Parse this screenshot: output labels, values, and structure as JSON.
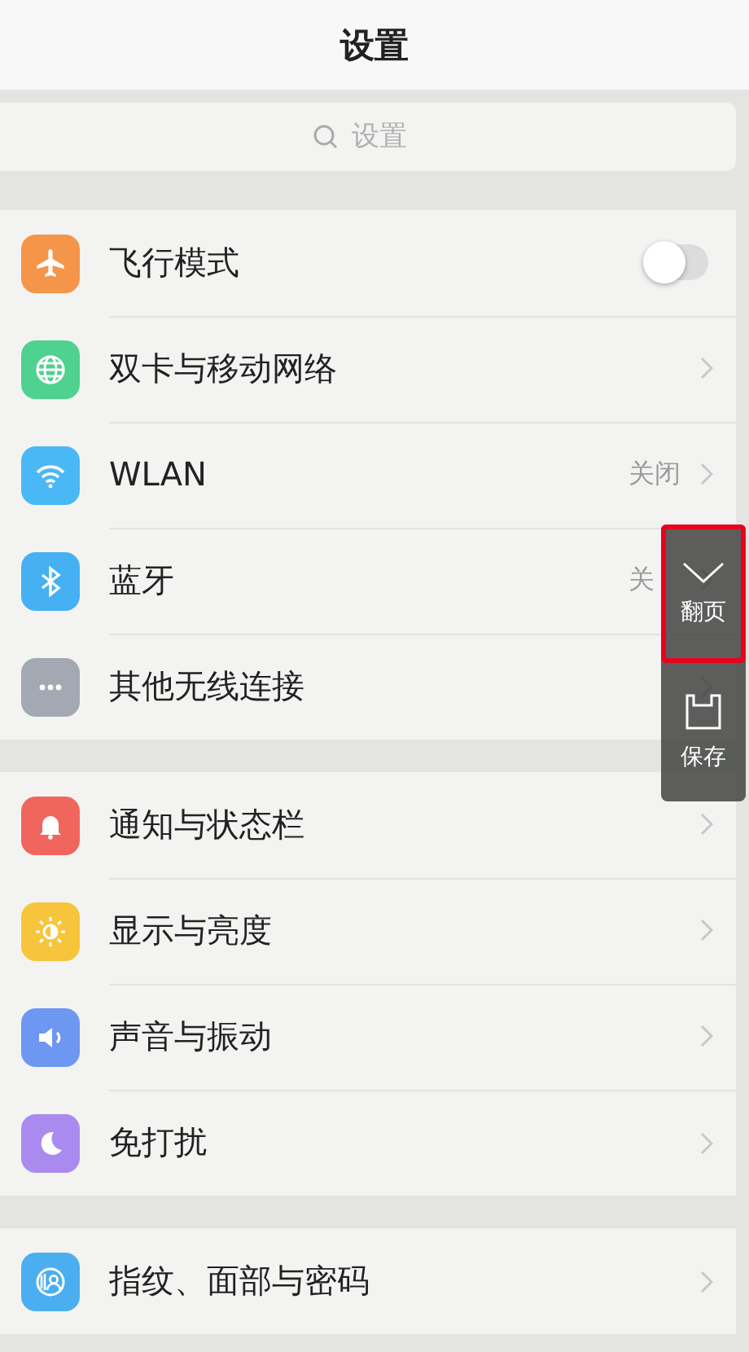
{
  "header": {
    "title": "设置"
  },
  "search": {
    "placeholder": "设置"
  },
  "groups": [
    {
      "items": [
        {
          "label": "飞行模式",
          "kind": "toggle",
          "on": false,
          "color": "#f5954a"
        },
        {
          "label": "双卡与移动网络",
          "kind": "link",
          "color": "#4fd18f"
        },
        {
          "label": "WLAN",
          "kind": "link",
          "value": "关闭",
          "color": "#4ab8f5"
        },
        {
          "label": "蓝牙",
          "kind": "link",
          "value": "关",
          "color": "#45b0f2"
        },
        {
          "label": "其他无线连接",
          "kind": "link",
          "color": "#a3a8b2"
        }
      ]
    },
    {
      "items": [
        {
          "label": "通知与状态栏",
          "kind": "link",
          "color": "#f0665e"
        },
        {
          "label": "显示与亮度",
          "kind": "link",
          "color": "#f7c53c"
        },
        {
          "label": "声音与振动",
          "kind": "link",
          "color": "#6e97f2"
        },
        {
          "label": "免打扰",
          "kind": "link",
          "color": "#a98bf0"
        }
      ]
    },
    {
      "items": [
        {
          "label": "指纹、面部与密码",
          "kind": "link",
          "color": "#4aaef0"
        }
      ]
    }
  ],
  "float_menu": [
    {
      "label": "翻页",
      "kind": "page",
      "selected": true
    },
    {
      "label": "保存",
      "kind": "save",
      "selected": false
    }
  ]
}
